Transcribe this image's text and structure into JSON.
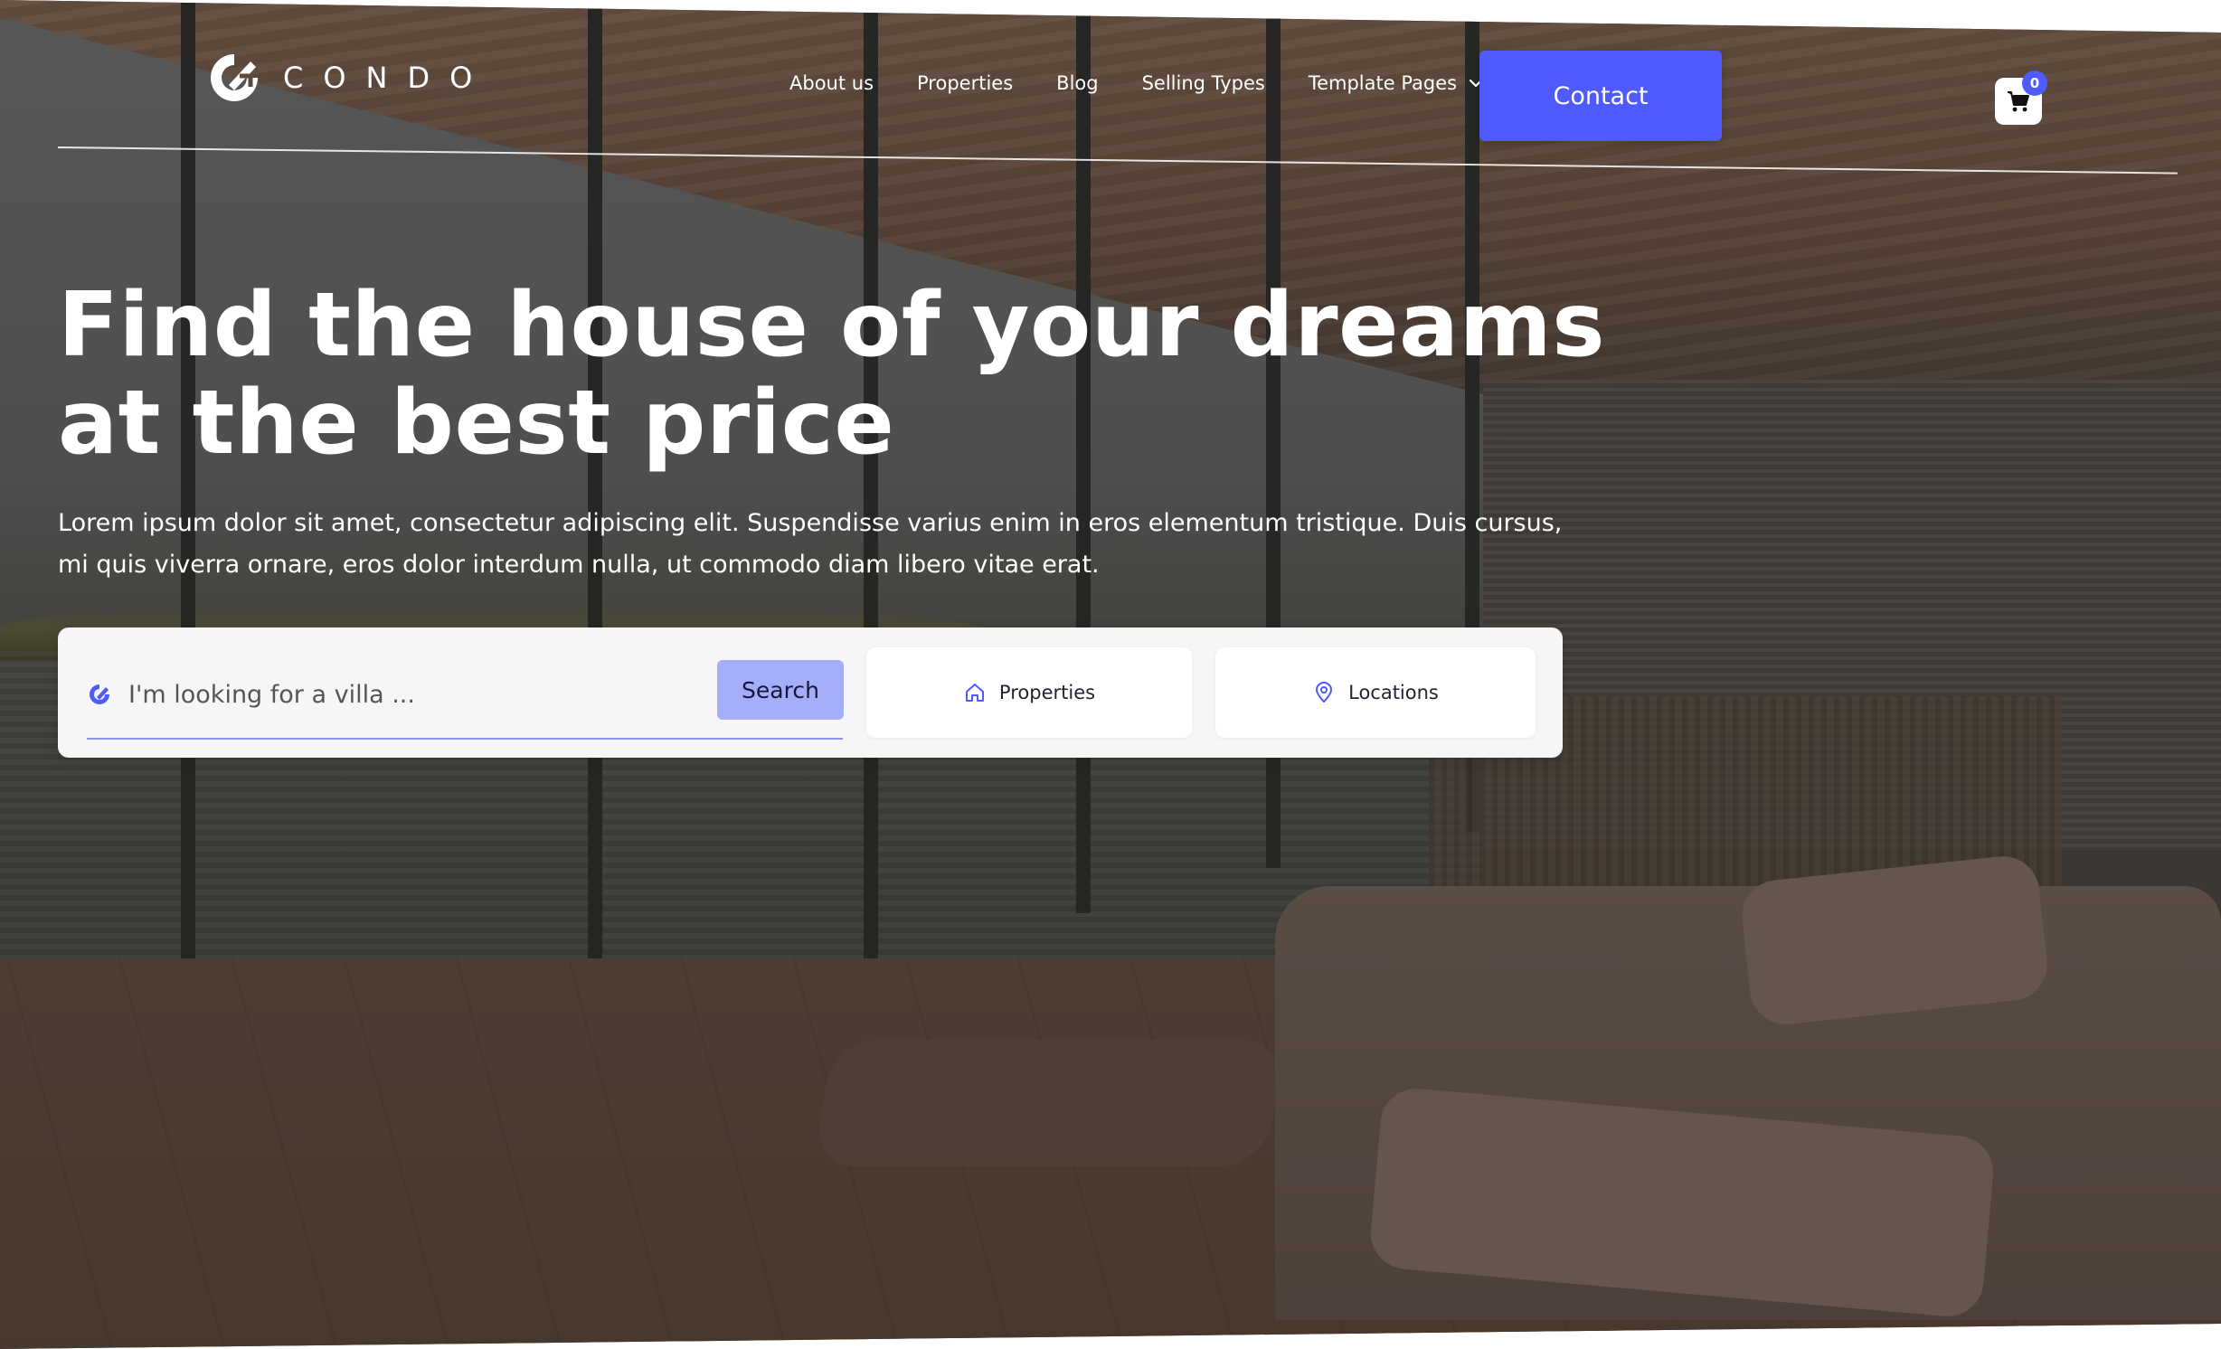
{
  "brand": {
    "name": "CONDO"
  },
  "nav": {
    "links": [
      "About us",
      "Properties",
      "Blog",
      "Selling Types"
    ],
    "dropdown_label": "Template Pages",
    "contact_label": "Contact",
    "cart_count": "0"
  },
  "hero": {
    "title": "Find the house of your dreams at the best price",
    "subtitle": "Lorem ipsum dolor sit amet, consectetur adipiscing elit. Suspendisse varius enim in eros elementum tristique. Duis cursus, mi quis viverra ornare, eros dolor interdum nulla, ut commodo diam libero vitae erat."
  },
  "search": {
    "placeholder": "I'm looking for a villa ...",
    "button_label": "Search",
    "properties_label": "Properties",
    "locations_label": "Locations"
  },
  "colors": {
    "accent": "#4f5bff",
    "search_button": "#a6aefc",
    "panel_bg": "#f6f6f8"
  },
  "icons": [
    "condo-logo-icon",
    "chevron-down-icon",
    "cart-icon",
    "search-logo-icon",
    "home-icon",
    "location-pin-icon"
  ]
}
